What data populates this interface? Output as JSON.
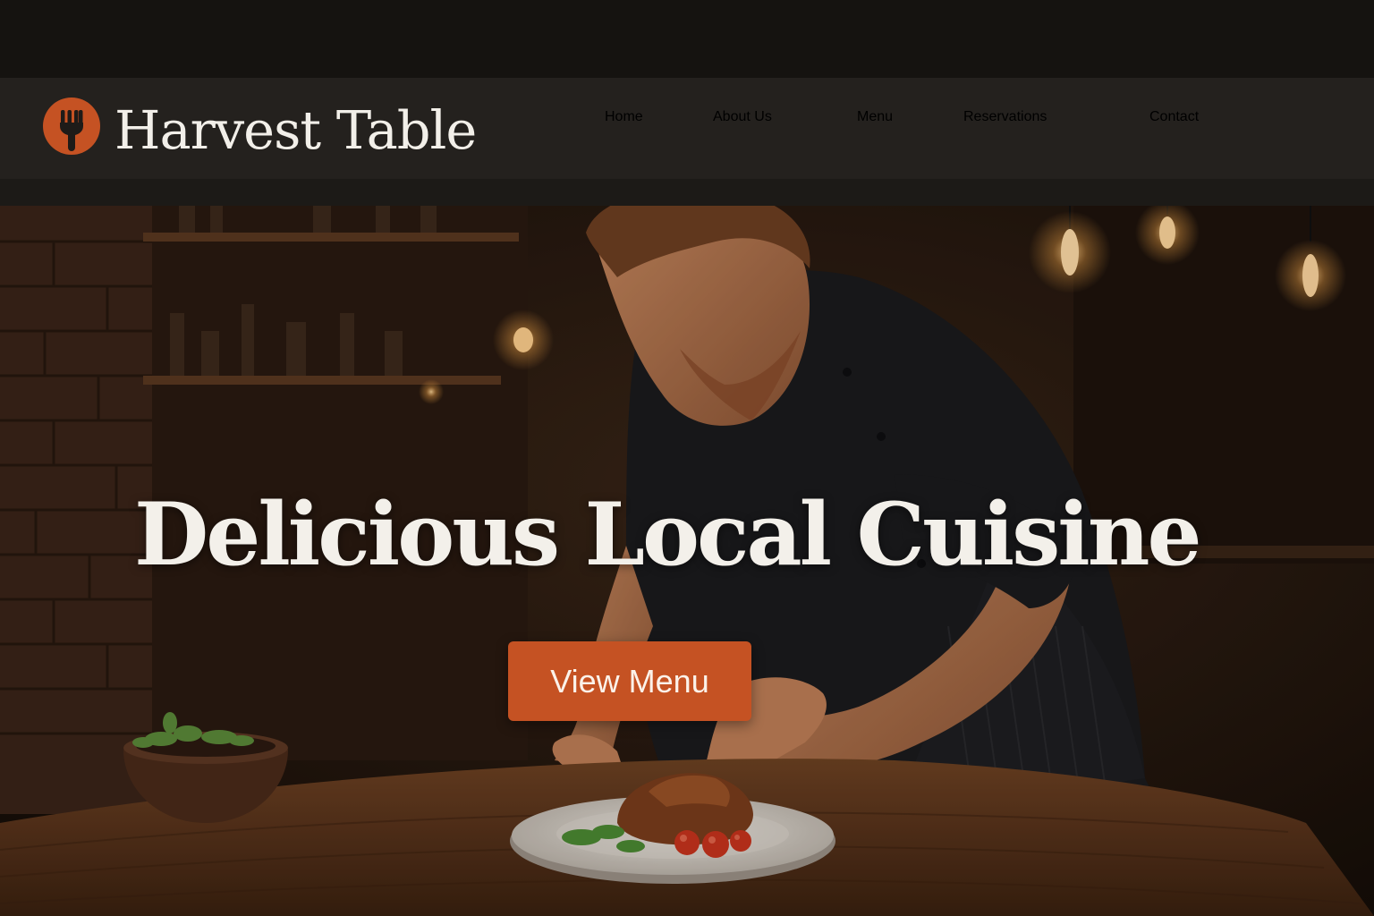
{
  "header": {
    "brand_name": "Harvest Table",
    "logo_icon": "fork-icon",
    "nav": [
      {
        "label": "Home"
      },
      {
        "label": "About Us"
      },
      {
        "label": "Menu"
      },
      {
        "label": "Reservations"
      },
      {
        "label": "Contact"
      }
    ]
  },
  "hero": {
    "headline": "Delicious Local Cuisine",
    "cta_label": "View Menu",
    "background_image": "chef plating a dish on a wooden table in a rustic restaurant"
  },
  "colors": {
    "accent": "#c55223",
    "navbar": "#24211e",
    "text": "#f2efe9"
  }
}
